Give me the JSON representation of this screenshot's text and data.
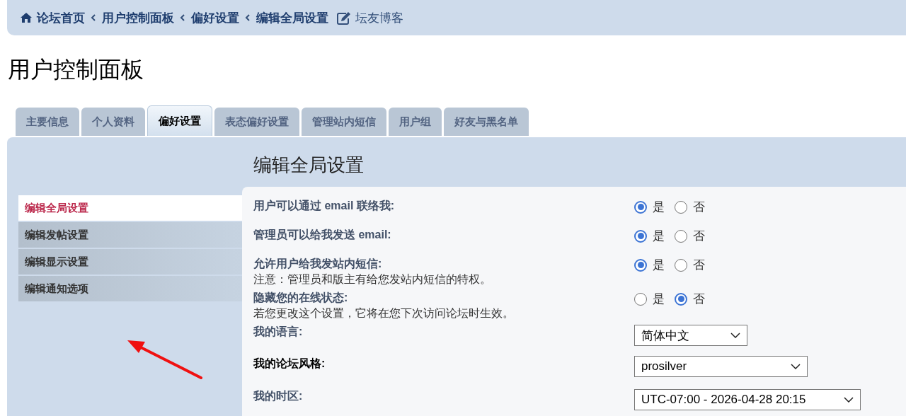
{
  "breadcrumbs": {
    "items": [
      {
        "label": "论坛首页",
        "kind": "home"
      },
      {
        "label": "用户控制面板",
        "kind": "link"
      },
      {
        "label": "偏好设置",
        "kind": "link"
      },
      {
        "label": "编辑全局设置",
        "kind": "link"
      }
    ],
    "extra": {
      "label": "坛友博客"
    }
  },
  "page_title": "用户控制面板",
  "tabs": [
    {
      "label": "主要信息",
      "selected": false
    },
    {
      "label": "个人资料",
      "selected": false
    },
    {
      "label": "偏好设置",
      "selected": true
    },
    {
      "label": "表态偏好设置",
      "selected": false
    },
    {
      "label": "管理站内短信",
      "selected": false
    },
    {
      "label": "用户组",
      "selected": false
    },
    {
      "label": "好友与黑名单",
      "selected": false
    }
  ],
  "sidebar": {
    "items": [
      {
        "label": "编辑全局设置",
        "selected": true
      },
      {
        "label": "编辑发帖设置",
        "selected": false
      },
      {
        "label": "编辑显示设置",
        "selected": false
      },
      {
        "label": "编辑通知选项",
        "selected": false
      }
    ]
  },
  "heading": "编辑全局设置",
  "settings": [
    {
      "kind": "radio",
      "label": "用户可以通过 email 联络我:",
      "options": [
        {
          "label": "是",
          "selected": true
        },
        {
          "label": "否",
          "selected": false
        }
      ]
    },
    {
      "kind": "radio",
      "label": "管理员可以给我发送 email:",
      "options": [
        {
          "label": "是",
          "selected": true
        },
        {
          "label": "否",
          "selected": false
        }
      ]
    },
    {
      "kind": "radio",
      "label": "允许用户给我发站内短信:",
      "note": "注意：管理员和版主有给您发站内短信的特权。",
      "options": [
        {
          "label": "是",
          "selected": true
        },
        {
          "label": "否",
          "selected": false
        }
      ]
    },
    {
      "kind": "radio",
      "label": "隐藏您的在线状态:",
      "note": "若您更改这个设置，它将在您下次访问论坛时生效。",
      "options": [
        {
          "label": "是",
          "selected": false
        },
        {
          "label": "否",
          "selected": true
        }
      ]
    },
    {
      "kind": "select",
      "label": "我的语言:",
      "value": "简体中文"
    },
    {
      "kind": "select",
      "label": "我的论坛风格:",
      "value": "prosilver"
    },
    {
      "kind": "select",
      "label": "我的时区:",
      "value": "UTC-07:00 - 2026-04-28 20:15"
    }
  ]
}
